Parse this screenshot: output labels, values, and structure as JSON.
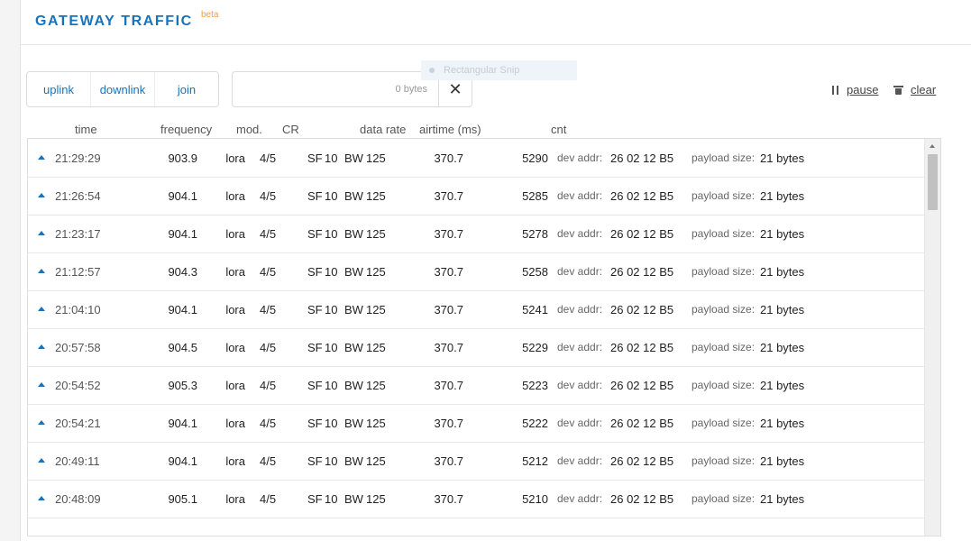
{
  "header": {
    "title": "GATEWAY TRAFFIC",
    "beta": "beta"
  },
  "tabs": [
    {
      "label": "uplink"
    },
    {
      "label": "downlink"
    },
    {
      "label": "join"
    }
  ],
  "search": {
    "value": "",
    "placeholder": "0 bytes",
    "clear_icon": "close-icon"
  },
  "snip": {
    "label": "Rectangular Snip"
  },
  "controls": {
    "pause_label": "pause",
    "clear_label": "clear"
  },
  "columns": {
    "time": "time",
    "frequency": "frequency",
    "mod": "mod.",
    "cr": "CR",
    "data_rate": "data rate",
    "airtime": "airtime (ms)",
    "cnt": "cnt"
  },
  "rows": [
    {
      "time": "21:29:29",
      "frequency": "903.9",
      "mod": "lora",
      "cr": "4/5",
      "sf_label": "SF",
      "sf": "10",
      "bw_label": "BW",
      "bw": "125",
      "airtime": "370.7",
      "cnt": "5290",
      "dev_addr_label": "dev addr:",
      "dev_addr": "26 02 12 B5",
      "payload_label": "payload size:",
      "payload": "21 bytes"
    },
    {
      "time": "21:26:54",
      "frequency": "904.1",
      "mod": "lora",
      "cr": "4/5",
      "sf_label": "SF",
      "sf": "10",
      "bw_label": "BW",
      "bw": "125",
      "airtime": "370.7",
      "cnt": "5285",
      "dev_addr_label": "dev addr:",
      "dev_addr": "26 02 12 B5",
      "payload_label": "payload size:",
      "payload": "21 bytes"
    },
    {
      "time": "21:23:17",
      "frequency": "904.1",
      "mod": "lora",
      "cr": "4/5",
      "sf_label": "SF",
      "sf": "10",
      "bw_label": "BW",
      "bw": "125",
      "airtime": "370.7",
      "cnt": "5278",
      "dev_addr_label": "dev addr:",
      "dev_addr": "26 02 12 B5",
      "payload_label": "payload size:",
      "payload": "21 bytes"
    },
    {
      "time": "21:12:57",
      "frequency": "904.3",
      "mod": "lora",
      "cr": "4/5",
      "sf_label": "SF",
      "sf": "10",
      "bw_label": "BW",
      "bw": "125",
      "airtime": "370.7",
      "cnt": "5258",
      "dev_addr_label": "dev addr:",
      "dev_addr": "26 02 12 B5",
      "payload_label": "payload size:",
      "payload": "21 bytes"
    },
    {
      "time": "21:04:10",
      "frequency": "904.1",
      "mod": "lora",
      "cr": "4/5",
      "sf_label": "SF",
      "sf": "10",
      "bw_label": "BW",
      "bw": "125",
      "airtime": "370.7",
      "cnt": "5241",
      "dev_addr_label": "dev addr:",
      "dev_addr": "26 02 12 B5",
      "payload_label": "payload size:",
      "payload": "21 bytes"
    },
    {
      "time": "20:57:58",
      "frequency": "904.5",
      "mod": "lora",
      "cr": "4/5",
      "sf_label": "SF",
      "sf": "10",
      "bw_label": "BW",
      "bw": "125",
      "airtime": "370.7",
      "cnt": "5229",
      "dev_addr_label": "dev addr:",
      "dev_addr": "26 02 12 B5",
      "payload_label": "payload size:",
      "payload": "21 bytes"
    },
    {
      "time": "20:54:52",
      "frequency": "905.3",
      "mod": "lora",
      "cr": "4/5",
      "sf_label": "SF",
      "sf": "10",
      "bw_label": "BW",
      "bw": "125",
      "airtime": "370.7",
      "cnt": "5223",
      "dev_addr_label": "dev addr:",
      "dev_addr": "26 02 12 B5",
      "payload_label": "payload size:",
      "payload": "21 bytes"
    },
    {
      "time": "20:54:21",
      "frequency": "904.1",
      "mod": "lora",
      "cr": "4/5",
      "sf_label": "SF",
      "sf": "10",
      "bw_label": "BW",
      "bw": "125",
      "airtime": "370.7",
      "cnt": "5222",
      "dev_addr_label": "dev addr:",
      "dev_addr": "26 02 12 B5",
      "payload_label": "payload size:",
      "payload": "21 bytes"
    },
    {
      "time": "20:49:11",
      "frequency": "904.1",
      "mod": "lora",
      "cr": "4/5",
      "sf_label": "SF",
      "sf": "10",
      "bw_label": "BW",
      "bw": "125",
      "airtime": "370.7",
      "cnt": "5212",
      "dev_addr_label": "dev addr:",
      "dev_addr": "26 02 12 B5",
      "payload_label": "payload size:",
      "payload": "21 bytes"
    },
    {
      "time": "20:48:09",
      "frequency": "905.1",
      "mod": "lora",
      "cr": "4/5",
      "sf_label": "SF",
      "sf": "10",
      "bw_label": "BW",
      "bw": "125",
      "airtime": "370.7",
      "cnt": "5210",
      "dev_addr_label": "dev addr:",
      "dev_addr": "26 02 12 B5",
      "payload_label": "payload size:",
      "payload": "21 bytes"
    }
  ],
  "colors": {
    "accent": "#1a73b8",
    "beta": "#e8a33d"
  }
}
